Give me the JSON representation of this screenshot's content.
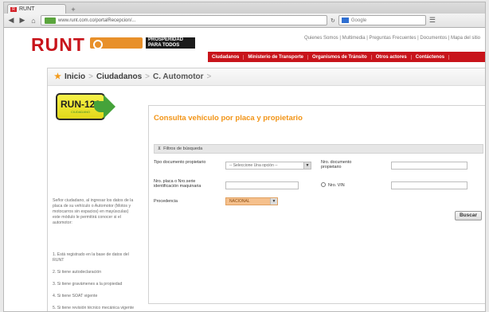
{
  "browser": {
    "tab_title": "RUNT",
    "url": "www.runt.com.co/portalRecepcion/...",
    "search_placeholder": "Google"
  },
  "header": {
    "logo": "RUNT",
    "gov_badge_text": "PROSPERIDAD PARA TODOS",
    "top_links": "Quienes Somos | Multimedia | Preguntas Frecuentes | Documentos | Mapa del sitio",
    "menu": [
      "Ciudadanos",
      "Ministerio de Transporte",
      "Organismos de Tránsito",
      "Otros actores",
      "Contáctenos"
    ]
  },
  "breadcrumb": [
    "Inicio",
    "Ciudadanos",
    "C. Automotor"
  ],
  "sidebar": {
    "badge_title": "RUN-123",
    "badge_sub": "CIUDADANO",
    "intro": "Señor ciudadano, al ingresar los datos de la placa de su vehículo o Automotor (Motos y motocarros sin espacios) en mayúsculas) este módulo le permitirá conocer si el automotor:",
    "steps": [
      "1. Está registrado en la base de datos del RUNT",
      "2. Si tiene autodeclaración",
      "3. Si tiene gravámenes a la propiedad",
      "4. Si tiene SOAT vigente",
      "5. Si tiene revisión técnico mecánica vigente"
    ]
  },
  "form": {
    "title": "Consulta vehículo por placa y propietario",
    "filter_label": "Filtros de búsqueda",
    "tipo_doc_label": "Tipo documento propietario",
    "tipo_doc_value": "-- Seleccione Una opción --",
    "nro_doc_label": "Nro. documento propietario",
    "placa_label": "Nro. placa o Nro.serie identificación maquinaria",
    "vin_label": "Nro. VIN",
    "procedencia_label": "Procedencia",
    "procedencia_value": "NACIONAL",
    "search_button": "Buscar"
  }
}
